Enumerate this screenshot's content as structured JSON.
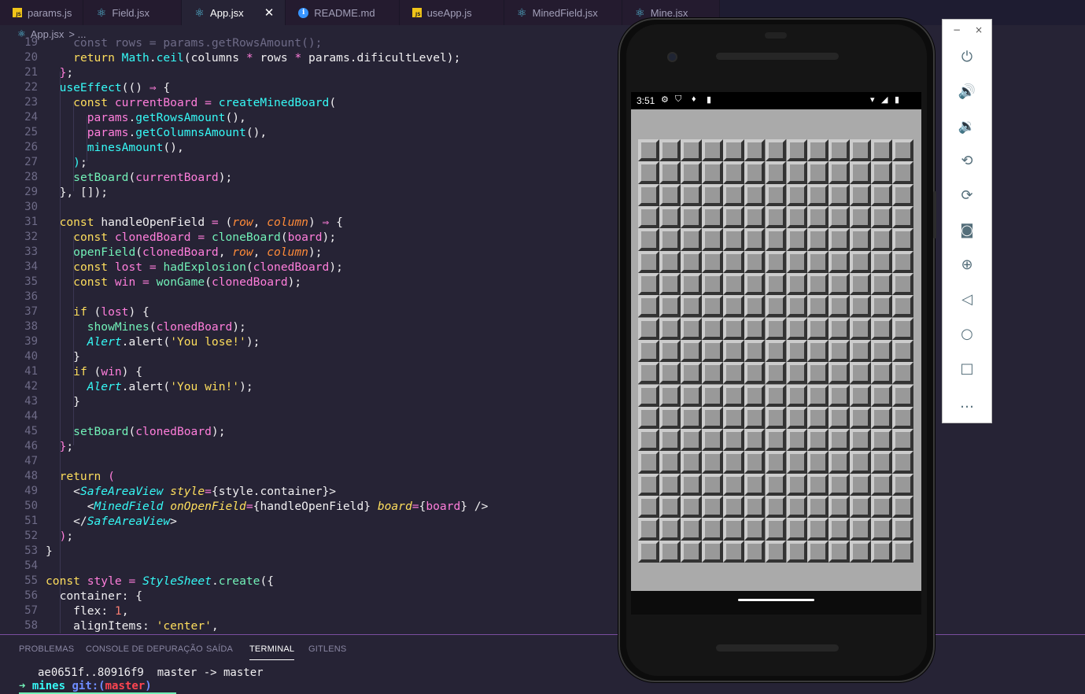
{
  "tabs": [
    {
      "label": "params.js",
      "icon": "js-file-icon",
      "active": false
    },
    {
      "label": "Field.jsx",
      "icon": "react-icon",
      "active": false
    },
    {
      "label": "App.jsx",
      "icon": "react-icon",
      "active": true
    },
    {
      "label": "README.md",
      "icon": "info-icon",
      "active": false
    },
    {
      "label": "useApp.js",
      "icon": "js-file-icon",
      "active": false
    },
    {
      "label": "MinedField.jsx",
      "icon": "react-icon",
      "active": false
    },
    {
      "label": "Mine.jsx",
      "icon": "react-icon",
      "active": false
    }
  ],
  "breadcrumb": {
    "file": "App.jsx",
    "rest": "> ..."
  },
  "line_numbers": [
    "19",
    "20",
    "21",
    "22",
    "23",
    "24",
    "25",
    "26",
    "27",
    "28",
    "29",
    "30",
    "31",
    "32",
    "33",
    "34",
    "35",
    "36",
    "37",
    "38",
    "39",
    "40",
    "41",
    "42",
    "43",
    "44",
    "45",
    "46",
    "47",
    "48",
    "49",
    "50",
    "51",
    "52",
    "53",
    "54",
    "55",
    "56",
    "57",
    "58"
  ],
  "panel": {
    "tabs": [
      "PROBLEMAS",
      "CONSOLE DE DEPURAÇÃO",
      "SAÍDA",
      "TERMINAL",
      "GITLENS"
    ],
    "active_tab": "TERMINAL",
    "terminal_line1": "ae0651f..80916f9  master -> master",
    "prompt_arrow": "➜",
    "prompt_dir": "mines",
    "prompt_git": "git:(",
    "prompt_branch": "master",
    "prompt_close": ")"
  },
  "phone": {
    "status_time": "3:51",
    "grid_rows": 19,
    "grid_cols": 13
  },
  "emulator_toolbar": {
    "minimize": "−",
    "close": "×",
    "buttons": [
      "power-icon",
      "volume-up-icon",
      "volume-down-icon",
      "rotate-left-icon",
      "rotate-right-icon",
      "camera-icon",
      "zoom-icon",
      "back-icon",
      "home-icon",
      "overview-icon",
      "more-icon"
    ]
  },
  "colors": {
    "editor_bg": "#262335",
    "keyword": "#fede5d",
    "function": "#36f9f6",
    "variable": "#ff7edb",
    "string": "#ff8b39",
    "tag": "#72f1b8",
    "mine_cell": "#999999",
    "screen_bg": "#aaaaaa"
  }
}
